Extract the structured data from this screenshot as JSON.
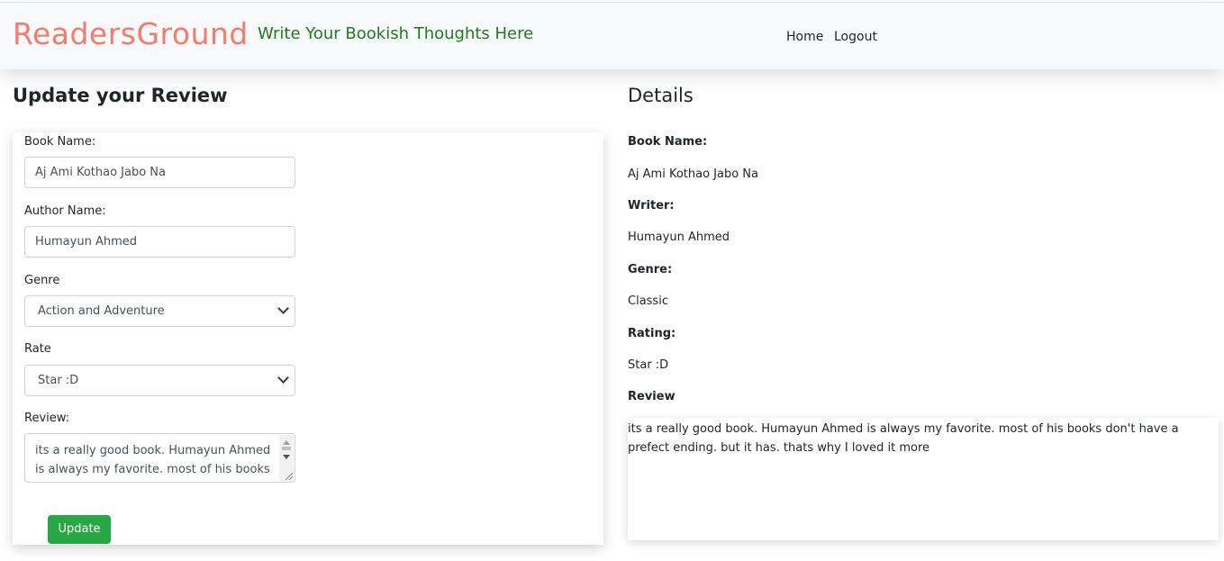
{
  "navbar": {
    "brand": "ReadersGround",
    "tagline": "Write Your Bookish Thoughts Here",
    "links": [
      "Home",
      "Logout"
    ]
  },
  "form": {
    "title": "Update your Review",
    "book_name_label": "Book Name:",
    "book_name_value": "Aj Ami Kothao Jabo Na",
    "author_label": "Author Name:",
    "author_value": "Humayun Ahmed",
    "genre_label": "Genre",
    "genre_selected": "Action and Adventure",
    "rate_label": "Rate",
    "rate_selected": "Star :D",
    "review_label": "Review:",
    "review_value": " its a really good book. Humayun Ahmed is always my favorite. most of his books",
    "update_button": "Update"
  },
  "details": {
    "title": "Details",
    "book_name_label": "Book Name:",
    "book_name_value": "Aj Ami Kothao Jabo Na",
    "writer_label": "Writer:",
    "writer_value": "Humayun Ahmed",
    "genre_label": "Genre:",
    "genre_value": "Classic",
    "rating_label": "Rating:",
    "rating_value": "Star :D",
    "review_label": "Review",
    "review_value": "its a really good book. Humayun Ahmed is always my favorite. most of his books don't have a prefect ending. but it has. thats why I loved it more"
  }
}
